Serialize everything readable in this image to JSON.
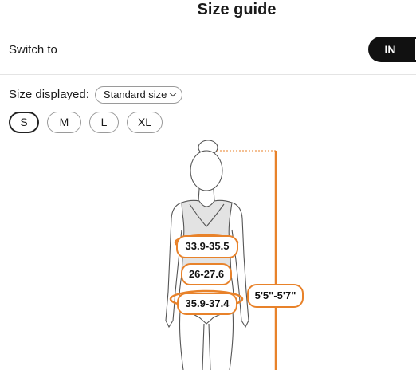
{
  "header": {
    "title": "Size guide"
  },
  "switch": {
    "label": "Switch to",
    "unit": "IN"
  },
  "size_displayed": {
    "label": "Size displayed:",
    "selected": "Standard size"
  },
  "sizes": [
    "S",
    "M",
    "L",
    "XL"
  ],
  "selected_size": "S",
  "measurements": {
    "bust": "33.9-35.5",
    "waist": "26-27.6",
    "hips": "35.9-37.4",
    "height": "5'5\"-5'7\""
  },
  "colors": {
    "accent": "#e8822a",
    "toggle": "#111111",
    "bodice": "#e3e3e3"
  }
}
